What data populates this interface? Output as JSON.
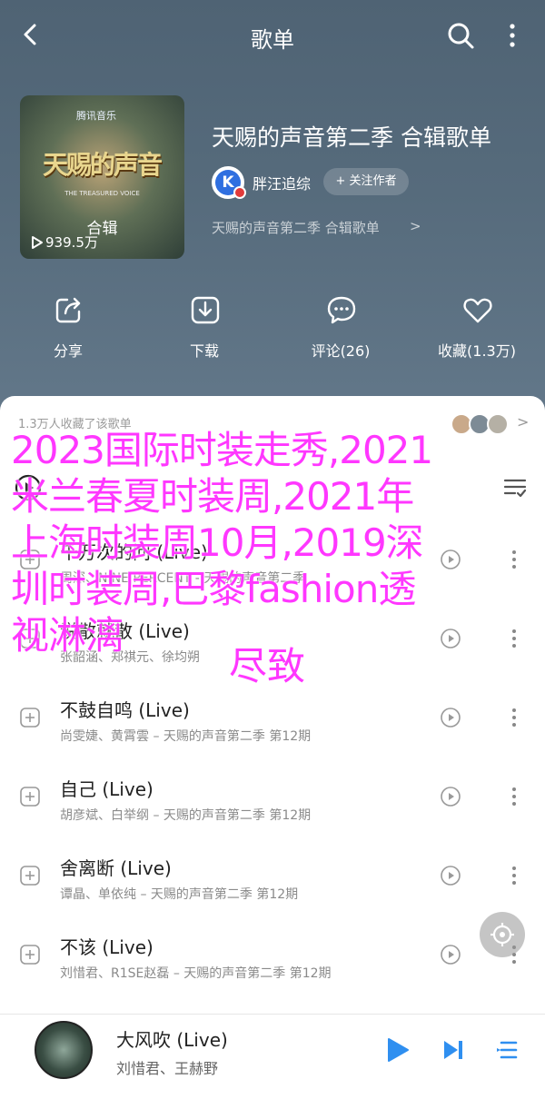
{
  "header": {
    "title": "歌单",
    "cover": {
      "brand": "腾讯音乐",
      "logo": "天赐的声音",
      "subtitle": "THE TREASURED VOICE",
      "tag": "合辑",
      "plays": "939.5万"
    },
    "album_title": "天赐的声音第二季 合辑歌单",
    "creator": "胖汪追综",
    "follow_label": "+ 关注作者",
    "description": "天赐的声音第二季 合辑歌单",
    "description_arrow": ">"
  },
  "actions": [
    {
      "label": "分享"
    },
    {
      "label": "下载"
    },
    {
      "label": "评论(26)"
    },
    {
      "label": "收藏(1.3万)"
    }
  ],
  "collect": {
    "text": "1.3万人收藏了该歌单",
    "arrow": ">"
  },
  "songs": [
    {
      "title": "千万次的问 (Live)",
      "meta": "周深、NINE PERCENT - 天赐的声音第二季"
    },
    {
      "title": "说散就散 (Live)",
      "meta": "张韶涵、郑祺元、徐均朔"
    },
    {
      "title": "不鼓自鸣 (Live)",
      "meta": "尚雯婕、黄霄雲 – 天赐的声音第二季 第12期"
    },
    {
      "title": "自己 (Live)",
      "meta": "胡彦斌、白举纲 – 天赐的声音第二季 第12期"
    },
    {
      "title": "舍离断 (Live)",
      "meta": "谭晶、单依纯 – 天赐的声音第二季 第12期"
    },
    {
      "title": "不该 (Live)",
      "meta": "刘惜君、R1SE赵磊 – 天赐的声音第二季 第12期"
    }
  ],
  "overlay": {
    "text": "2023国际时装走秀,2021米兰春夏时装周,2021年上海时装周10月,2019深圳时装周,巴黎fashion透视淋漓",
    "last": "尽致"
  },
  "player": {
    "title": "大风吹 (Live)",
    "artist": "刘惜君、王赫野"
  },
  "colors": {
    "accent": "#2f8ff0",
    "overlay": "#ff37ff",
    "header_bg": "#566b7c"
  }
}
